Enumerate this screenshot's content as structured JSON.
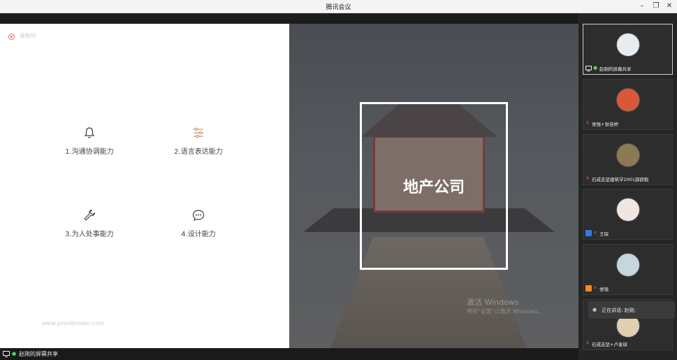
{
  "window": {
    "title": "腾讯会议",
    "controls": [
      "minimize",
      "restore",
      "close"
    ]
  },
  "slide": {
    "recording_text": "录制中",
    "skills": [
      {
        "label": "1.沟通协调能力",
        "icon": "bell-icon"
      },
      {
        "label": "2.语言表达能力",
        "icon": "sliders-icon"
      },
      {
        "label": "3.为人处事能力",
        "icon": "wrench-icon"
      },
      {
        "label": "4.设计能力",
        "icon": "chat-bubble-icon"
      }
    ],
    "domain": "www.yourdomain.com",
    "company": "地产公司",
    "watermark": {
      "line1": "激活 Windows",
      "line2": "转到\"设置\"以激活 Windows。"
    }
  },
  "bottombar": {
    "share_label": "赵刚的屏幕共享"
  },
  "participants": [
    {
      "name": "赵刚的屏幕共享",
      "badge": "screen",
      "active": true,
      "avatar_color": "#e6ecef"
    },
    {
      "name": "觉强+张佳婷",
      "badge": "mic-muted",
      "active": false,
      "avatar_color": "#d9583a"
    },
    {
      "name": "石成志坚建筑学2001邵辟毅",
      "badge": "mic-muted",
      "active": false,
      "avatar_color": "#8a7a55"
    },
    {
      "name": "王琛",
      "badge": "person-blue",
      "active": false,
      "avatar_color": "#efe6e2"
    },
    {
      "name": "觉强",
      "badge": "person-orange",
      "active": false,
      "avatar_color": "#c5d6dc"
    },
    {
      "name": "石成志坚+卢麦琛",
      "badge": "mic-muted",
      "active": false,
      "avatar_color": "#e2cfb0"
    }
  ],
  "speaking": {
    "text": "正在讲话: 赵刚;"
  }
}
